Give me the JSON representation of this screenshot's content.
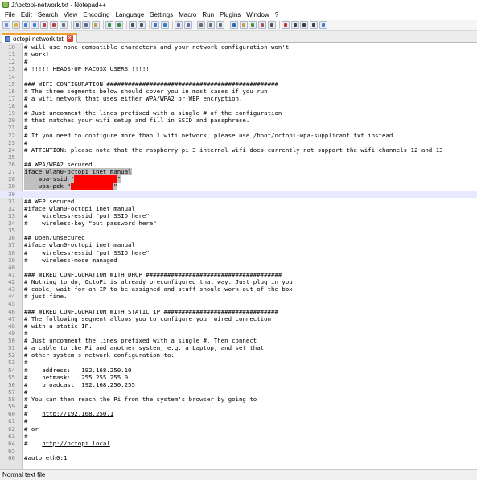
{
  "window": {
    "title": "J:\\octopi-network.txt - Notepad++"
  },
  "menu": [
    "File",
    "Edit",
    "Search",
    "View",
    "Encoding",
    "Language",
    "Settings",
    "Macro",
    "Run",
    "Plugins",
    "Window",
    "?"
  ],
  "toolbar": {
    "buttons": [
      {
        "name": "new-file-icon",
        "color": "#6f8fc8"
      },
      {
        "name": "open-file-icon",
        "color": "#e0b040"
      },
      {
        "name": "save-icon",
        "color": "#4a7ad0"
      },
      {
        "name": "save-all-icon",
        "color": "#4a7ad0"
      },
      {
        "name": "close-icon",
        "color": "#c04040"
      },
      {
        "name": "close-all-icon",
        "color": "#c04040"
      },
      {
        "name": "print-icon",
        "color": "#707070"
      },
      {
        "sep": true
      },
      {
        "name": "cut-icon",
        "color": "#5a6a8a"
      },
      {
        "name": "copy-icon",
        "color": "#5a6a8a"
      },
      {
        "name": "paste-icon",
        "color": "#c89a40"
      },
      {
        "sep": true
      },
      {
        "name": "undo-icon",
        "color": "#3a8a4a"
      },
      {
        "name": "redo-icon",
        "color": "#3a8a4a"
      },
      {
        "sep": true
      },
      {
        "name": "find-icon",
        "color": "#505050"
      },
      {
        "name": "replace-icon",
        "color": "#505050"
      },
      {
        "sep": true
      },
      {
        "name": "zoom-in-icon",
        "color": "#3a7ac0"
      },
      {
        "name": "zoom-out-icon",
        "color": "#3a7ac0"
      },
      {
        "sep": true
      },
      {
        "name": "sync-vertical-icon",
        "color": "#6a6a9a"
      },
      {
        "name": "sync-horizontal-icon",
        "color": "#6a6a9a"
      },
      {
        "sep": true
      },
      {
        "name": "word-wrap-icon",
        "color": "#6a6a6a"
      },
      {
        "name": "show-all-chars-icon",
        "color": "#6a6a6a"
      },
      {
        "name": "indent-guide-icon",
        "color": "#6a6a6a"
      },
      {
        "sep": true
      },
      {
        "name": "language-icon",
        "color": "#2a6ab0"
      },
      {
        "name": "document-map-icon",
        "color": "#c8a040"
      },
      {
        "name": "function-list-icon",
        "color": "#4a8a4a"
      },
      {
        "name": "folder-workspace-icon",
        "color": "#b05050"
      },
      {
        "name": "monitoring-icon",
        "color": "#505050"
      },
      {
        "sep": true
      },
      {
        "name": "record-macro-icon",
        "color": "#d03030"
      },
      {
        "name": "stop-record-icon",
        "color": "#404040"
      },
      {
        "name": "playback-icon",
        "color": "#404040"
      },
      {
        "name": "run-macro-multiple-icon",
        "color": "#404040"
      },
      {
        "name": "save-macro-icon",
        "color": "#4a7ad0"
      }
    ]
  },
  "tab": {
    "label": "octopi-network.txt"
  },
  "editor": {
    "lines": [
      {
        "n": "10",
        "text": "# will use none-compatible characters and your network configuration won't"
      },
      {
        "n": "11",
        "text": "# work!"
      },
      {
        "n": "12",
        "text": "#"
      },
      {
        "n": "13",
        "text": "# !!!!! HEADS-UP MACOSX USERS !!!!!"
      },
      {
        "n": "14",
        "text": ""
      },
      {
        "n": "15",
        "text": "### WIFI CONFIGURATION ################################################"
      },
      {
        "n": "16",
        "text": "# The three segments below should cover you in most cases if you run"
      },
      {
        "n": "17",
        "text": "# a wifi network that uses either WPA/WPA2 or WEP encryption."
      },
      {
        "n": "18",
        "text": "#"
      },
      {
        "n": "19",
        "text": "# Just uncomment the lines prefixed with a single # of the configuration"
      },
      {
        "n": "20",
        "text": "# that matches your wifi setup and fill in SSID and passphrase."
      },
      {
        "n": "21",
        "text": "#"
      },
      {
        "n": "22",
        "text": "# If you need to configure more than 1 wifi network, please use /boot/octopi-wpa-supplicant.txt instead"
      },
      {
        "n": "23",
        "text": "#"
      },
      {
        "n": "24",
        "text": "# ATTENTION: please note that the raspberry pi 3 internal wifi does currently not support the wifi channels 12 and 13"
      },
      {
        "n": "25",
        "text": ""
      },
      {
        "n": "26",
        "text": "## WPA/WPA2 secured"
      },
      {
        "n": "27",
        "text": "iface wlan0-octopi inet manual",
        "sel": true
      },
      {
        "n": "28",
        "pre": "    wpa-ssid \"",
        "redact": "xxxxxxxxxxxx",
        "post": "\"",
        "sel": true
      },
      {
        "n": "29",
        "pre": "    wpa-psk \"",
        "redact": "xxxxxxxxxxxx",
        "post": "\"",
        "sel": true
      },
      {
        "n": "30",
        "text": "",
        "caret": true
      },
      {
        "n": "31",
        "text": "## WEP secured"
      },
      {
        "n": "32",
        "text": "#iface wlan0-octopi inet manual"
      },
      {
        "n": "33",
        "text": "#    wireless-essid \"put SSID here\""
      },
      {
        "n": "34",
        "text": "#    wireless-key \"put password here\""
      },
      {
        "n": "35",
        "text": ""
      },
      {
        "n": "36",
        "text": "## Open/unsecured"
      },
      {
        "n": "37",
        "text": "#iface wlan0-octopi inet manual"
      },
      {
        "n": "38",
        "text": "#    wireless-essid \"put SSID here\""
      },
      {
        "n": "39",
        "text": "#    wireless-mode managed"
      },
      {
        "n": "40",
        "text": ""
      },
      {
        "n": "41",
        "text": "### WIRED CONFIGURATION WITH DHCP ######################################"
      },
      {
        "n": "42",
        "text": "# Nothing to do, OctoPi is already preconfigured that way. Just plug in your"
      },
      {
        "n": "43",
        "text": "# cable, wait for an IP to be assigned and stuff should work out of the box"
      },
      {
        "n": "44",
        "text": "# just fine."
      },
      {
        "n": "45",
        "text": ""
      },
      {
        "n": "46",
        "text": "### WIRED CONFIGURATION WITH STATIC IP ################################"
      },
      {
        "n": "47",
        "text": "# The following segment allows you to configure your wired connection"
      },
      {
        "n": "48",
        "text": "# with a static IP."
      },
      {
        "n": "49",
        "text": "#"
      },
      {
        "n": "50",
        "text": "# Just uncomment the lines prefixed with a single #. Then connect"
      },
      {
        "n": "51",
        "text": "# a cable to the Pi and another system, e.g. a Laptop, and set that"
      },
      {
        "n": "52",
        "text": "# other system's network configuration to:"
      },
      {
        "n": "53",
        "text": "#"
      },
      {
        "n": "54",
        "text": "#    address:   192.168.250.10"
      },
      {
        "n": "55",
        "text": "#    netmask:   255.255.255.0"
      },
      {
        "n": "56",
        "text": "#    broadcast: 192.168.250.255"
      },
      {
        "n": "57",
        "text": "#"
      },
      {
        "n": "58",
        "text": "# You can then reach the Pi from the system's browser by going to"
      },
      {
        "n": "59",
        "text": "#"
      },
      {
        "n": "60",
        "pre": "#    ",
        "link": "http://192.168.250.1"
      },
      {
        "n": "61",
        "text": "#"
      },
      {
        "n": "62",
        "text": "# or"
      },
      {
        "n": "63",
        "text": "#"
      },
      {
        "n": "64",
        "pre": "#    ",
        "link": "http://octopi.local"
      },
      {
        "n": "65",
        "text": ""
      },
      {
        "n": "66",
        "text": "#auto eth0:1"
      }
    ]
  },
  "status": {
    "file_type": "Normal text file"
  }
}
